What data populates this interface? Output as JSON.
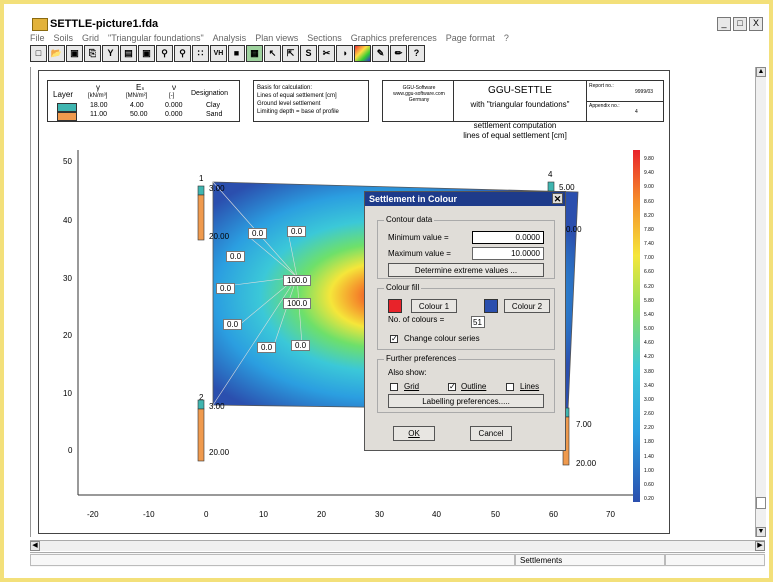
{
  "window": {
    "title": "SETTLE-picture1.fda",
    "buttons": [
      "_",
      "□",
      "X"
    ]
  },
  "menu": [
    "File",
    "Soils",
    "Grid",
    "\"Triangular foundations\"",
    "Analysis",
    "Plan views",
    "Sections",
    "Graphics preferences",
    "Page format",
    "?"
  ],
  "toolbar": [
    "D",
    "O",
    "S",
    "P",
    "Y",
    "E",
    "R",
    "Q",
    "Q",
    "G",
    "VH",
    "L",
    "T",
    "A",
    "B",
    "S",
    "C",
    "X",
    "Y",
    "Z",
    "W",
    "?"
  ],
  "legend": {
    "header_layer": "Layer",
    "header_gamma": "γ",
    "header_gamma_unit": "[kN/m³]",
    "header_es": "Eₛ",
    "header_es_unit": "[MN/m²]",
    "header_nu": "ν",
    "header_nu_unit": "[-]",
    "header_designation": "Designation",
    "rows": [
      {
        "color": "#3fb5b0",
        "gamma": "18.00",
        "es": "4.00",
        "nu": "0.000",
        "designation": "Clay"
      },
      {
        "color": "#ef9a4e",
        "gamma": "11.00",
        "es": "50.00",
        "nu": "0.000",
        "designation": "Sand"
      }
    ]
  },
  "basis": {
    "line1": "Basis for calculation:",
    "line2": "Lines of equal settlement [cm]",
    "line3": "Ground level settlement",
    "line4": "Limiting depth = base of profile"
  },
  "company": {
    "name": "GGU-Software",
    "url": "www.ggu-software.com",
    "country": "Germany"
  },
  "product": {
    "name": "GGU-SETTLE",
    "subtitle": "with \"triangular foundations\""
  },
  "report": {
    "report_label": "Report no.:",
    "report_value": "9999/03",
    "appendix_label": "Appendix no.:",
    "appendix_value": "4"
  },
  "plot": {
    "title": "settlement computation",
    "subtitle": "lines of equal settlement [cm]",
    "x_ticks": [
      "-20",
      "-10",
      "0",
      "10",
      "20",
      "30",
      "40",
      "50",
      "60",
      "70"
    ],
    "y_ticks": [
      "50",
      "40",
      "30",
      "20",
      "10",
      "0"
    ],
    "corner_labels": [
      "1",
      "4",
      "2",
      "3"
    ],
    "profile_top_labels": [
      "3.00",
      "20.00",
      "3.00",
      "20.00",
      "7.00",
      "20.00",
      "5.00",
      "0.00"
    ],
    "contour_labels": [
      "0.0",
      "0.0",
      "0.0",
      "100.0",
      "0.0",
      "100.0",
      "0.0",
      "0.0",
      "0.0"
    ],
    "colorbar": [
      "9.80",
      "9.40",
      "9.00",
      "8.60",
      "8.20",
      "7.80",
      "7.40",
      "7.00",
      "6.60",
      "6.20",
      "5.80",
      "5.40",
      "5.00",
      "4.60",
      "4.20",
      "3.80",
      "3.40",
      "3.00",
      "2.60",
      "2.20",
      "1.80",
      "1.40",
      "1.00",
      "0.60",
      "0.20"
    ]
  },
  "dialog": {
    "title": "Settlement in Colour",
    "contour_group": "Contour data",
    "min_label": "Minimum value =",
    "min_value": "0.0000",
    "max_label": "Maximum value =",
    "max_value": "10.0000",
    "determine_button": "Determine extreme values ...",
    "colour_group": "Colour fill",
    "colour1_button": "Colour 1",
    "colour2_button": "Colour 2",
    "colour1": "#e8232a",
    "colour2": "#2b4fae",
    "num_colours_label": "No. of colours =",
    "num_colours": "51",
    "change_series_label": "Change colour series",
    "change_series_checked": true,
    "further_group": "Further preferences",
    "also_show": "Also show:",
    "grid_label": "Grid",
    "grid_checked": false,
    "outline_label": "Outline",
    "outline_checked": true,
    "lines_label": "Lines",
    "lines_checked": false,
    "labelling_button": "Labelling preferences.....",
    "ok_button": "OK",
    "cancel_button": "Cancel"
  },
  "status": {
    "mode": "Settlements"
  }
}
